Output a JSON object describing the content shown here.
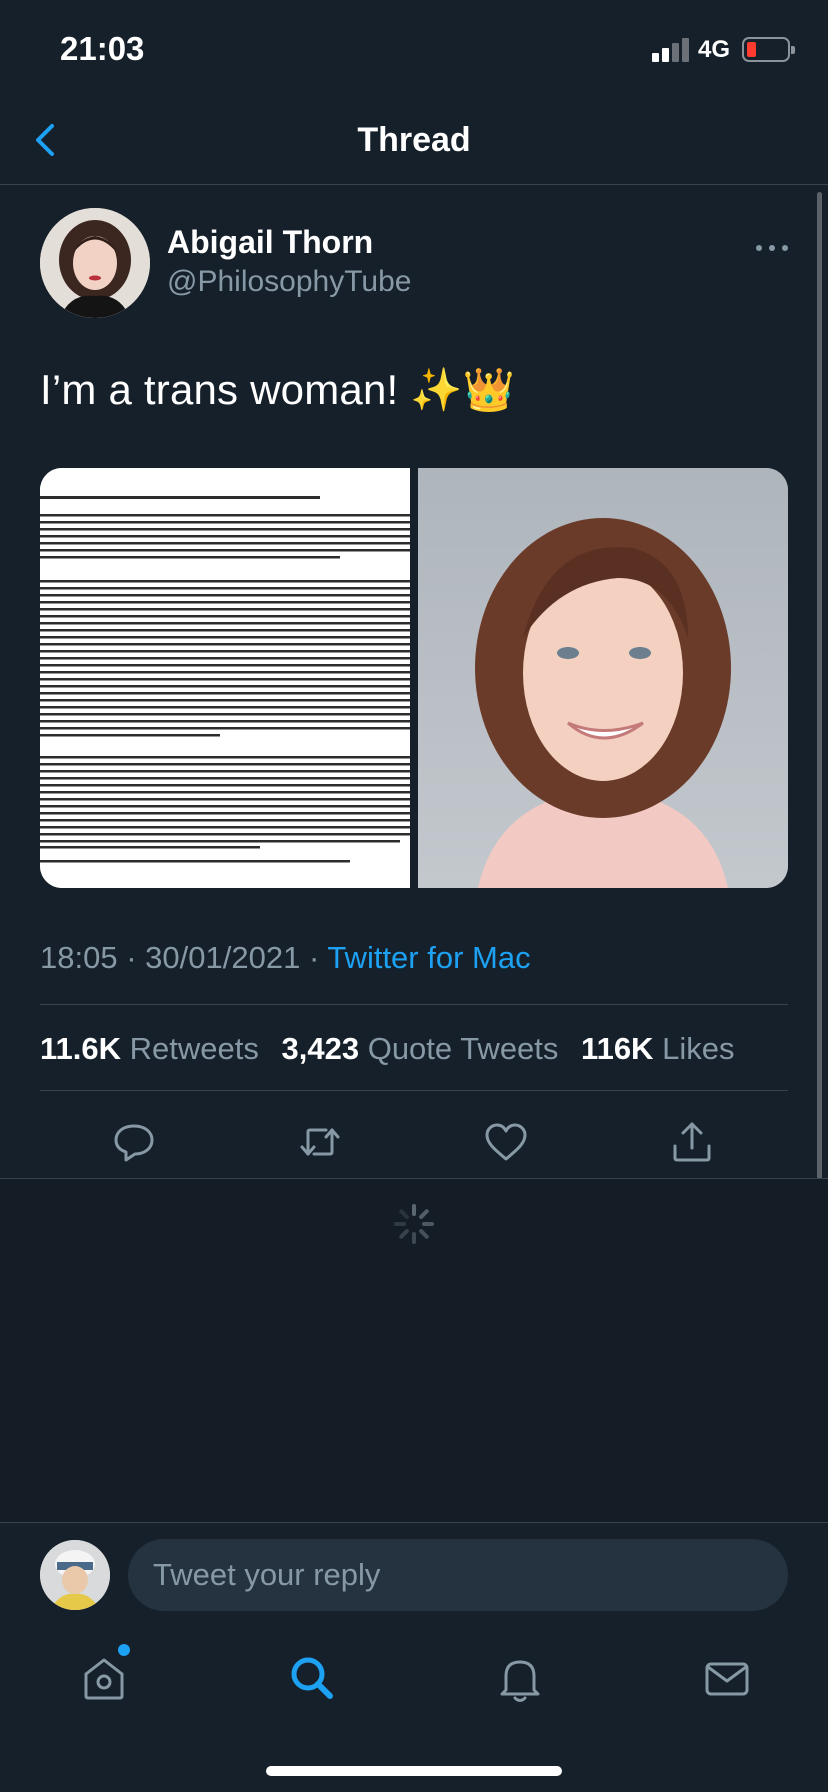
{
  "status_bar": {
    "time": "21:03",
    "network": "4G"
  },
  "header": {
    "title": "Thread"
  },
  "tweet": {
    "author_name": "Abigail Thorn",
    "author_handle": "@PhilosophyTube",
    "text": "I’m a trans woman! ✨👑",
    "time": "18:05",
    "date": "30/01/2021",
    "separator": "·",
    "source": "Twitter for Mac",
    "stats": {
      "retweets_count": "11.6K",
      "retweets_label": "Retweets",
      "quotes_count": "3,423",
      "quotes_label": "Quote Tweets",
      "likes_count": "116K",
      "likes_label": "Likes"
    },
    "media": [
      {
        "kind": "document-screenshot",
        "icon": "document-image"
      },
      {
        "kind": "portrait-photo",
        "icon": "portrait-image"
      }
    ]
  },
  "reply": {
    "placeholder": "Tweet your reply"
  },
  "tab_bar": {
    "items": [
      {
        "name": "home",
        "icon": "home-icon",
        "active": false
      },
      {
        "name": "search",
        "icon": "search-icon",
        "active": true
      },
      {
        "name": "notifications",
        "icon": "bell-icon",
        "active": false
      },
      {
        "name": "messages",
        "icon": "mail-icon",
        "active": false
      }
    ]
  },
  "colors": {
    "background": "#15202b",
    "accent": "#1da1f2",
    "secondary_text": "#8899a6",
    "divider": "#38444d"
  }
}
